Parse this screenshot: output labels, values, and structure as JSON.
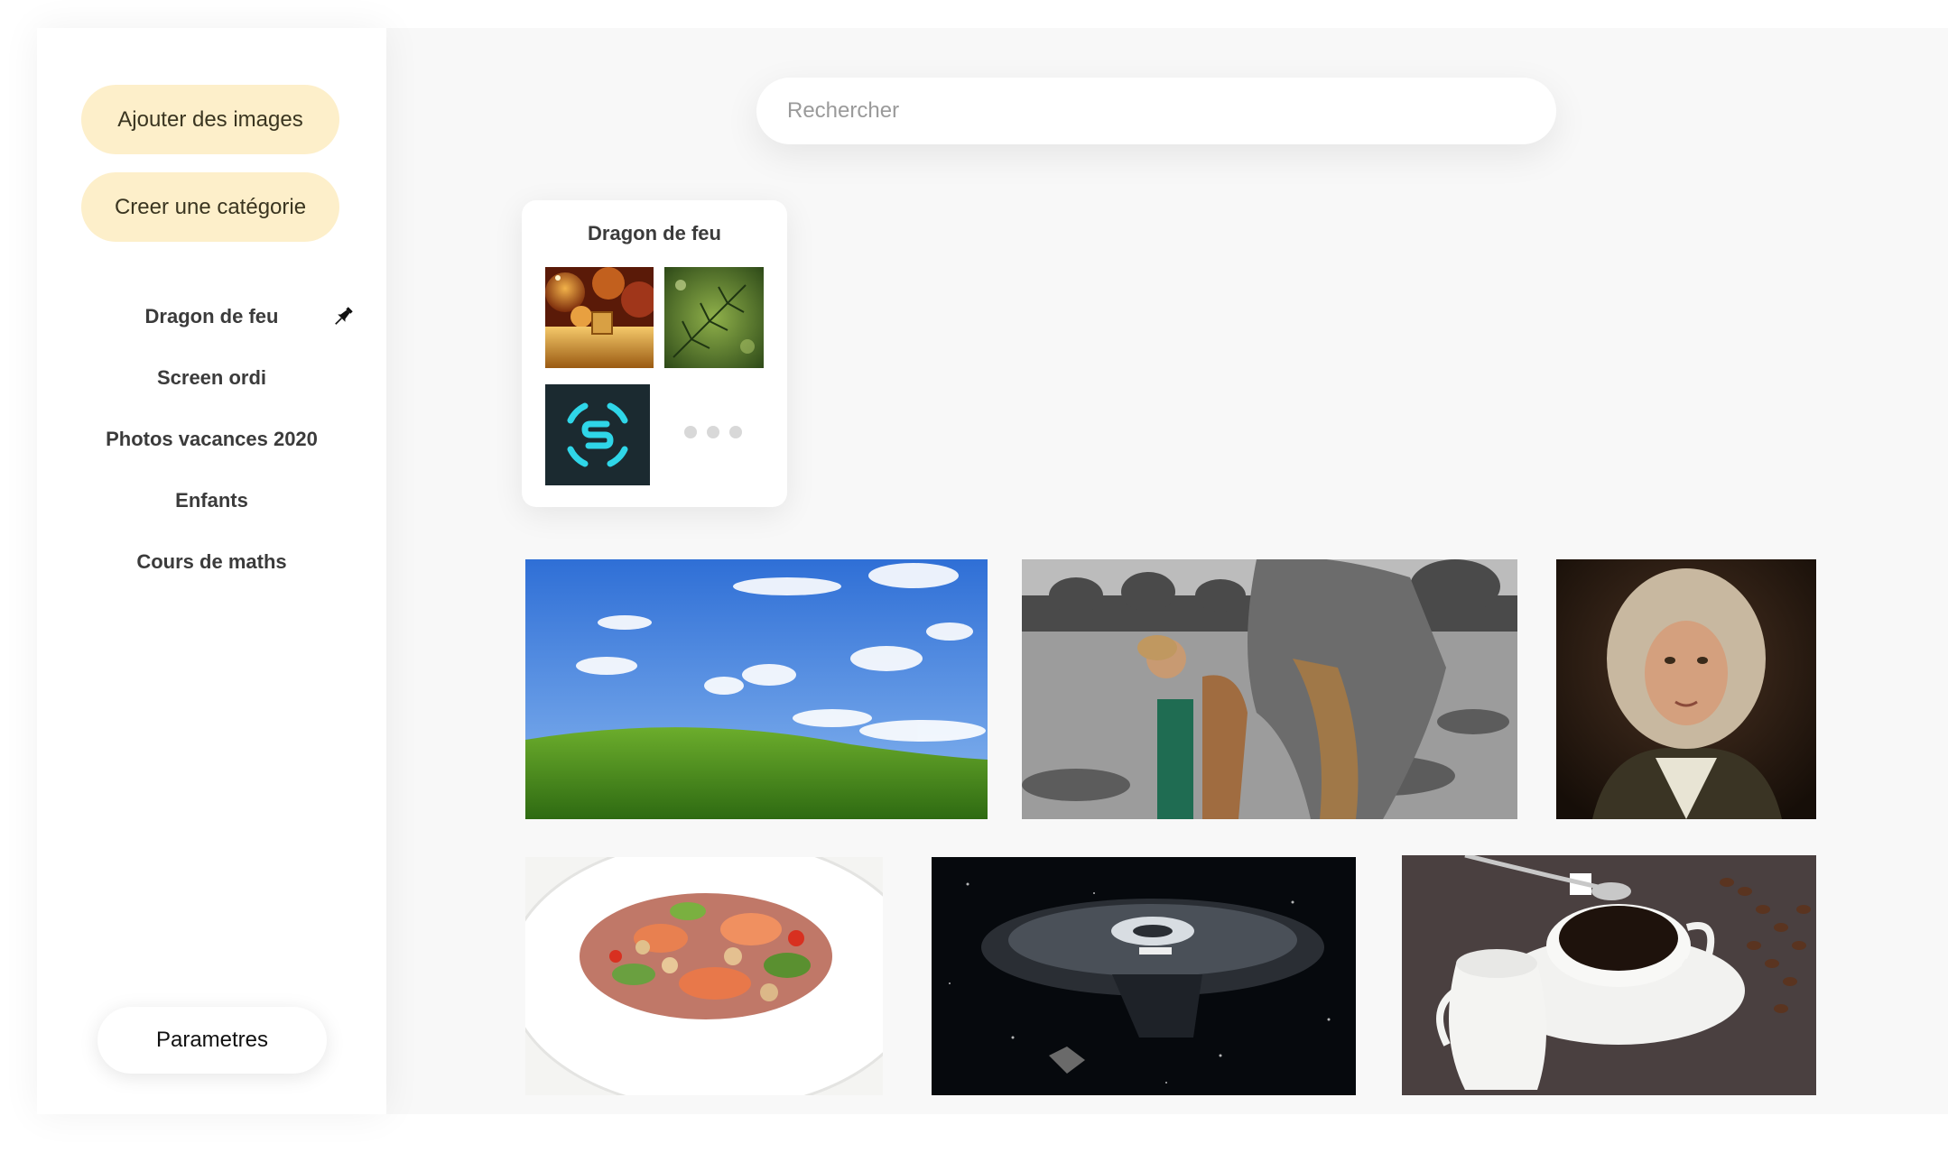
{
  "sidebar": {
    "add_images": "Ajouter des images",
    "create_category": "Creer une catégorie",
    "categories": [
      {
        "label": "Dragon de feu",
        "pinned": true
      },
      {
        "label": "Screen ordi"
      },
      {
        "label": "Photos vacances 2020"
      },
      {
        "label": "Enfants"
      },
      {
        "label": "Cours de maths"
      }
    ],
    "settings": "Parametres"
  },
  "search": {
    "placeholder": "Rechercher"
  },
  "category_card": {
    "title": "Dragon de feu",
    "thumbnails": [
      "golden-ornaments-photo",
      "pine-branch-photo",
      "cyan-logo-photo"
    ],
    "more_indicator": "ellipsis-dots"
  },
  "gallery": [
    {
      "name": "green-hill-sky-photo"
    },
    {
      "name": "woman-elephant-photo"
    },
    {
      "name": "baroque-portrait-photo"
    },
    {
      "name": "salad-plate-photo"
    },
    {
      "name": "spaceship-photo"
    },
    {
      "name": "coffee-cup-photo"
    }
  ],
  "colors": {
    "accent_button": "#fdefca",
    "background": "#f8f8f8",
    "sidebar": "#ffffff"
  }
}
